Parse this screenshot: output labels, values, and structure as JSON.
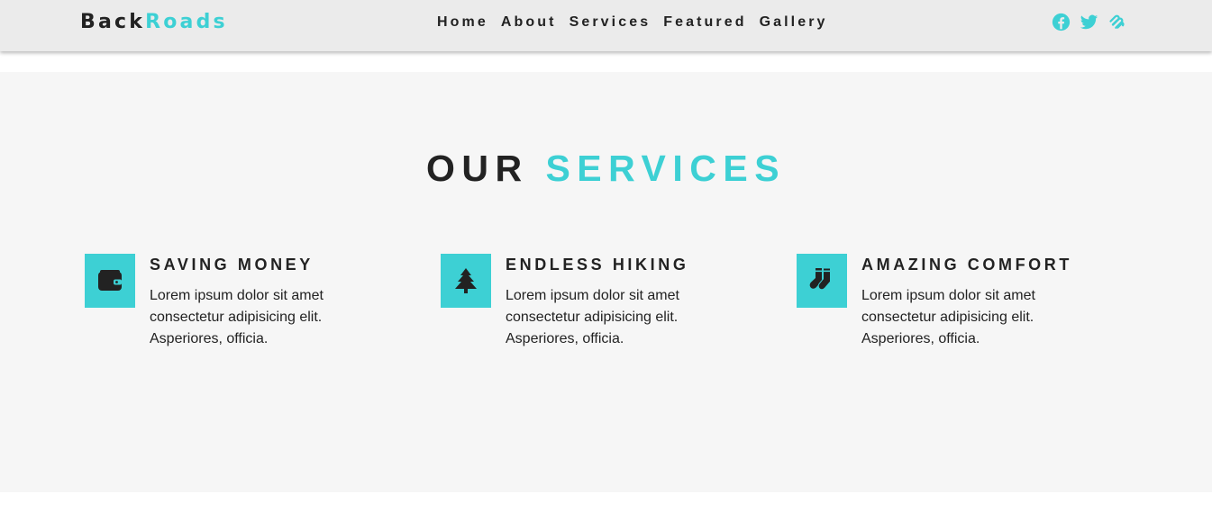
{
  "brand": {
    "part1": "Back",
    "part2": "Roads"
  },
  "nav": {
    "links": [
      "Home",
      "About",
      "Services",
      "Featured",
      "Gallery"
    ]
  },
  "social": {
    "icons": [
      "facebook-icon",
      "twitter-icon",
      "squarespace-icon"
    ]
  },
  "colors": {
    "accent": "#3dd0d4",
    "dark": "#222222",
    "navbar_bg": "#ebebeb",
    "section_bg": "#f6f6f6"
  },
  "services": {
    "title_part1": "OUR",
    "title_part2": "SERVICES",
    "items": [
      {
        "icon": "wallet-icon",
        "title": "SAVING MONEY",
        "text": "Lorem ipsum dolor sit amet consectetur adipisicing elit. Asperiores, officia."
      },
      {
        "icon": "tree-icon",
        "title": "ENDLESS HIKING",
        "text": "Lorem ipsum dolor sit amet consectetur adipisicing elit. Asperiores, officia."
      },
      {
        "icon": "socks-icon",
        "title": "AMAZING COMFORT",
        "text": "Lorem ipsum dolor sit amet consectetur adipisicing elit. Asperiores, officia."
      }
    ]
  }
}
